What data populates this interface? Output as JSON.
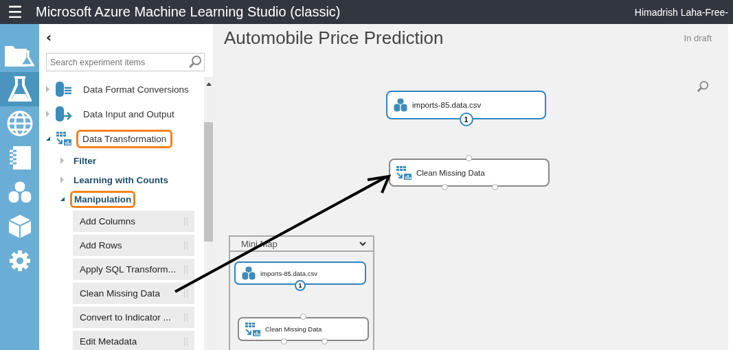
{
  "top_bar": {
    "menu_icon": "☰",
    "title": "Microsoft Azure Machine Learning Studio (classic)",
    "user": "Himadrish Laha-Free-"
  },
  "rail": [
    {
      "kind": "projects",
      "selected": false
    },
    {
      "kind": "experiments",
      "selected": true
    },
    {
      "kind": "web_services",
      "selected": false
    },
    {
      "kind": "notebooks",
      "selected": false
    },
    {
      "kind": "datasets",
      "selected": false
    },
    {
      "kind": "models",
      "selected": false
    },
    {
      "kind": "settings",
      "selected": false
    }
  ],
  "palette": {
    "collapse": "‹",
    "search": {
      "placeholder": "Search experiment items"
    },
    "tree": [
      {
        "label": "Data Format Conversions",
        "expanded": false,
        "highlighted": false
      },
      {
        "label": "Data Input and Output",
        "expanded": false,
        "highlighted": false
      },
      {
        "label": "Data Transformation",
        "expanded": true,
        "highlighted": true,
        "children": [
          {
            "label": "Filter",
            "expanded": false,
            "highlighted": false
          },
          {
            "label": "Learning with Counts",
            "expanded": false,
            "highlighted": false
          },
          {
            "label": "Manipulation",
            "expanded": true,
            "highlighted": true,
            "children": [
              {
                "label": "Add Columns"
              },
              {
                "label": "Add Rows"
              },
              {
                "label": "Apply SQL Transform..."
              },
              {
                "label": "Clean Missing Data"
              },
              {
                "label": "Convert to Indicator ..."
              },
              {
                "label": "Edit Metadata"
              }
            ]
          }
        ]
      }
    ]
  },
  "canvas": {
    "title": "Automobile Price Prediction",
    "status": "In draft",
    "nodes": [
      {
        "label": "imports-85.data.csv",
        "kind": "dataset",
        "selected": true,
        "output": "1"
      },
      {
        "label": "Clean Missing Data",
        "kind": "module",
        "selected": false
      }
    ],
    "mini_map": {
      "title": "Mini Map",
      "nodes": [
        {
          "label": "imports-85.data.csv",
          "kind": "dataset",
          "selected": true,
          "output": "1"
        },
        {
          "label": "Clean Missing Data",
          "kind": "module",
          "selected": false
        }
      ]
    }
  }
}
